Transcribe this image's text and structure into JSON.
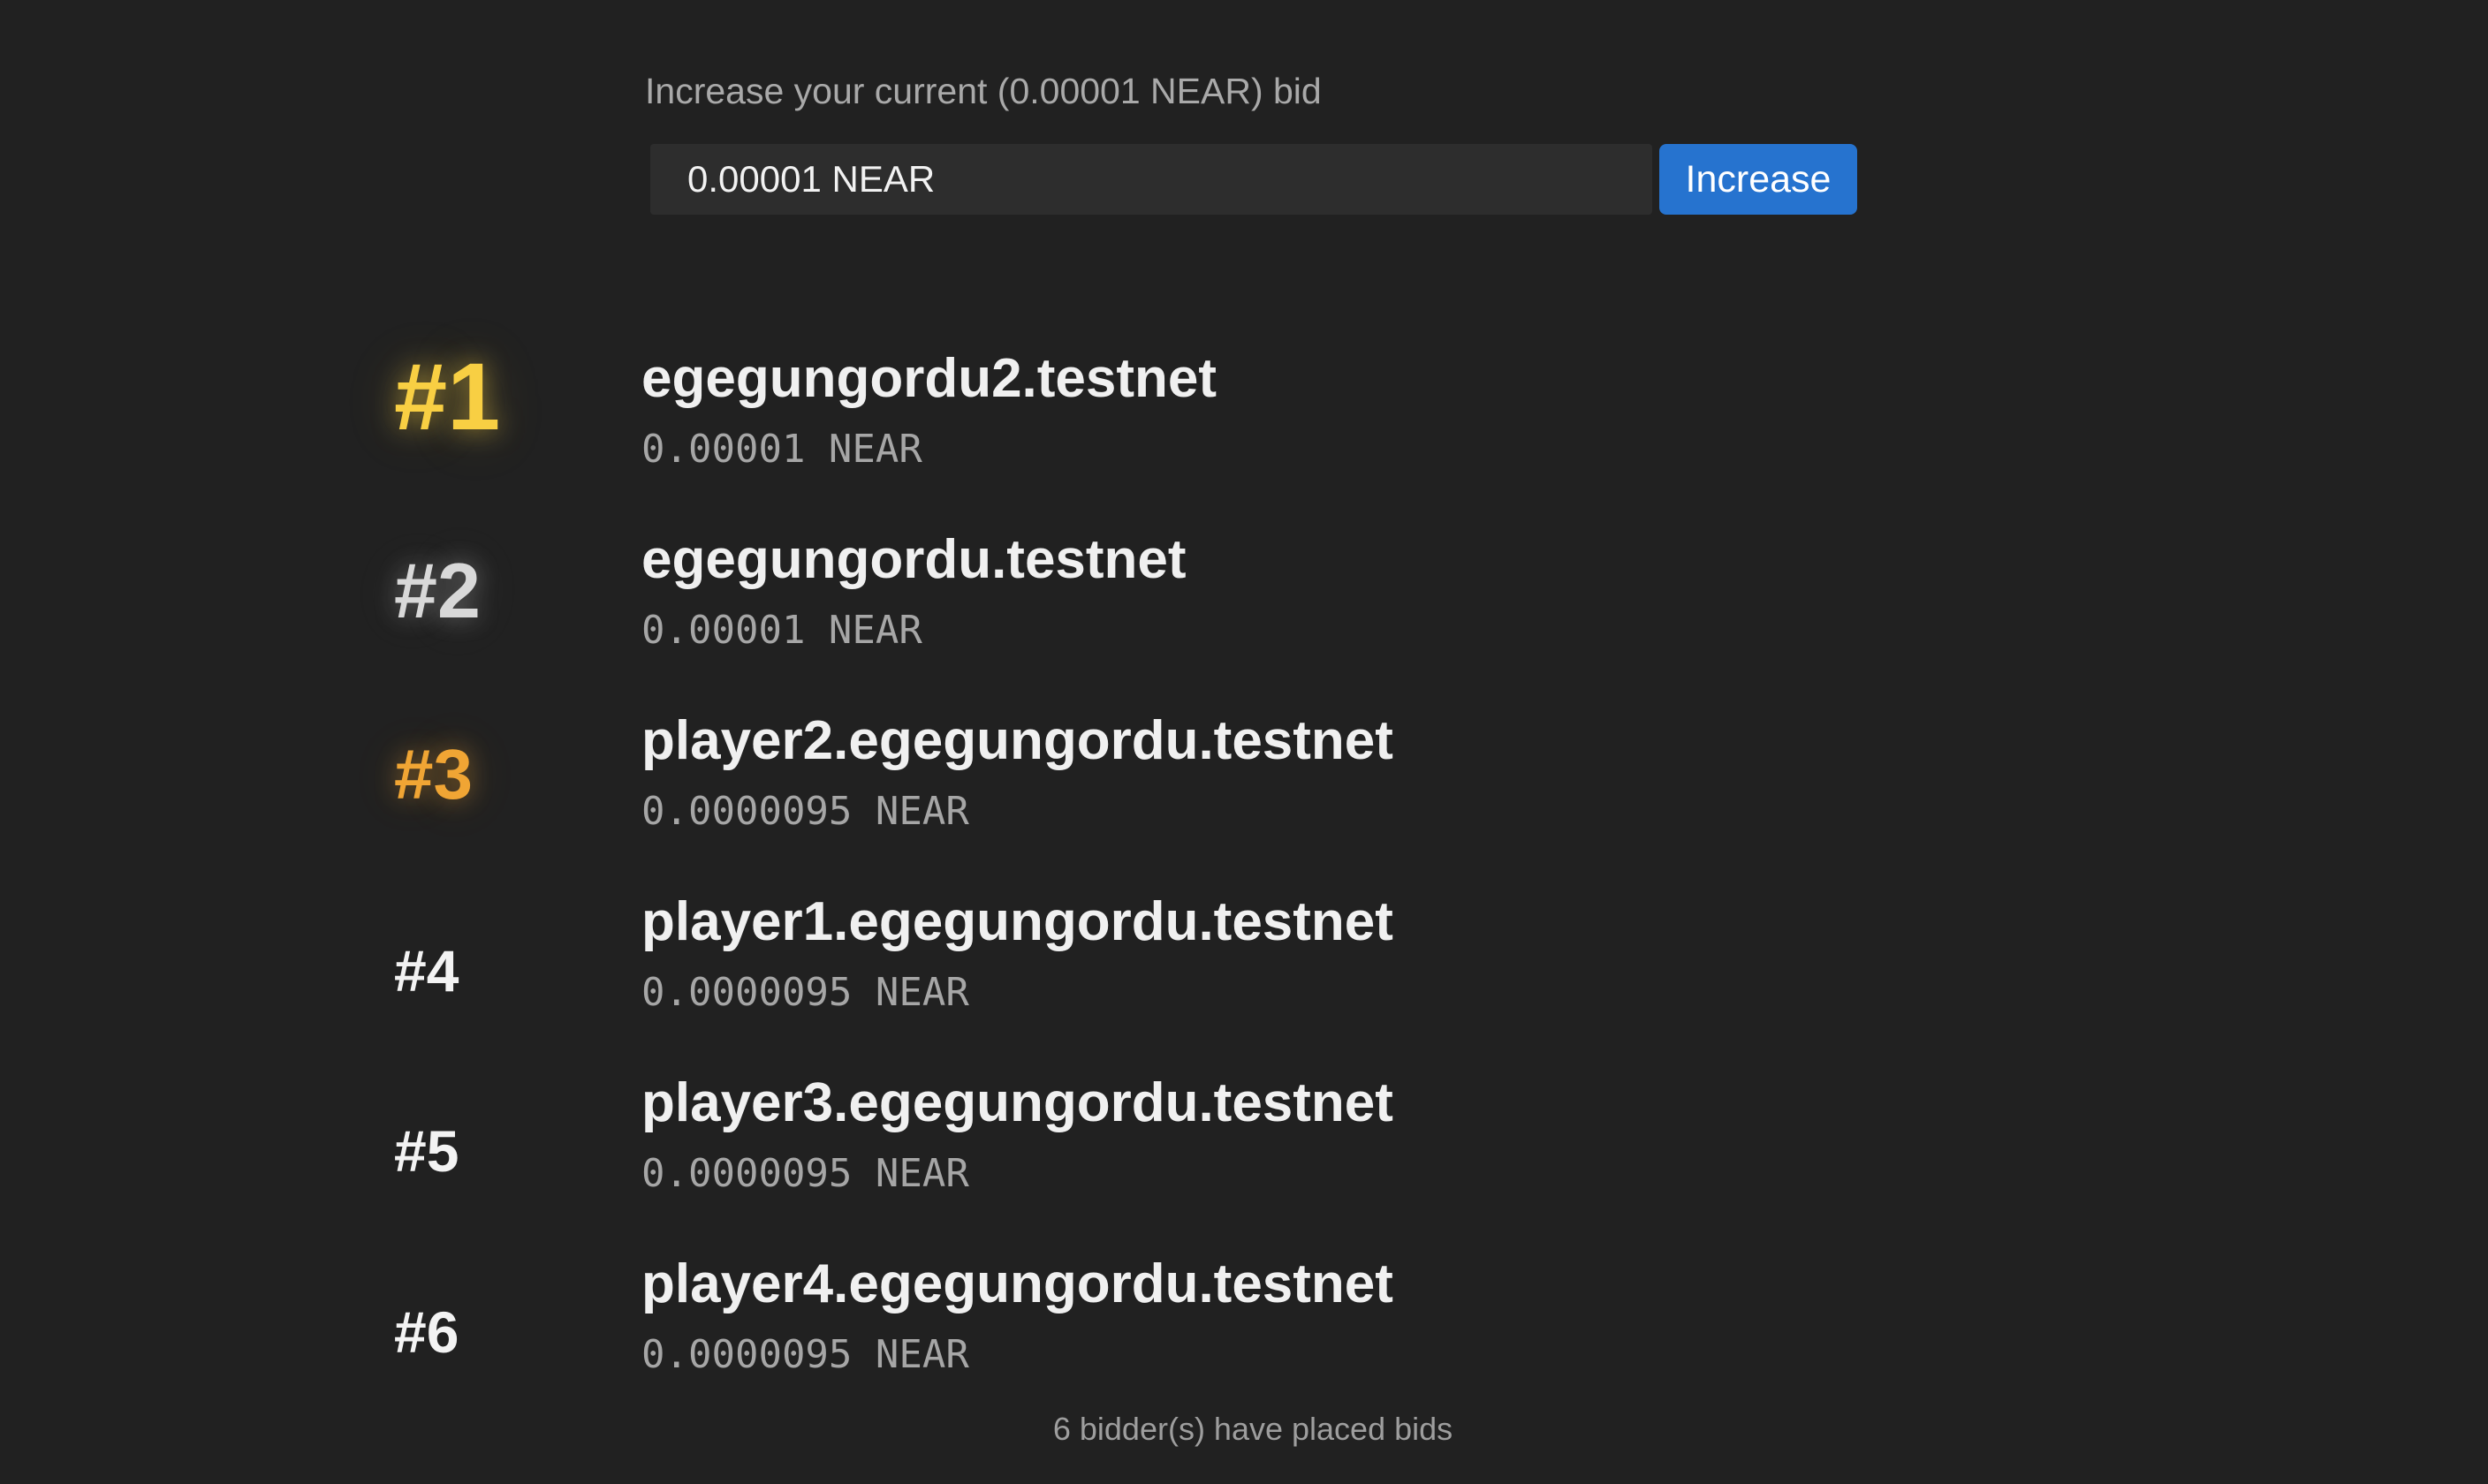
{
  "bid_form": {
    "label": "Increase your current (0.00001 NEAR) bid",
    "input_value": "0.00001 NEAR",
    "button_label": "Increase",
    "button_color": "#2673cf"
  },
  "leaderboard": {
    "entries": [
      {
        "rank": "#1",
        "name": "egegungordu2.testnet",
        "amount": "0.00001 NEAR",
        "rank_color": "#f8cf43"
      },
      {
        "rank": "#2",
        "name": "egegungordu.testnet",
        "amount": "0.00001 NEAR",
        "rank_color": "#d8d8d8"
      },
      {
        "rank": "#3",
        "name": "player2.egegungordu.testnet",
        "amount": "0.0000095 NEAR",
        "rank_color": "#f0a534"
      },
      {
        "rank": "#4",
        "name": "player1.egegungordu.testnet",
        "amount": "0.0000095 NEAR",
        "rank_color": "#f3f3f3"
      },
      {
        "rank": "#5",
        "name": "player3.egegungordu.testnet",
        "amount": "0.0000095 NEAR",
        "rank_color": "#f3f3f3"
      },
      {
        "rank": "#6",
        "name": "player4.egegungordu.testnet",
        "amount": "0.0000095 NEAR",
        "rank_color": "#f3f3f3"
      }
    ]
  },
  "footer": {
    "bidder_count_text": "6 bidder(s) have placed bids"
  },
  "colors": {
    "background": "#212121",
    "input_background": "#2d2d2d"
  }
}
